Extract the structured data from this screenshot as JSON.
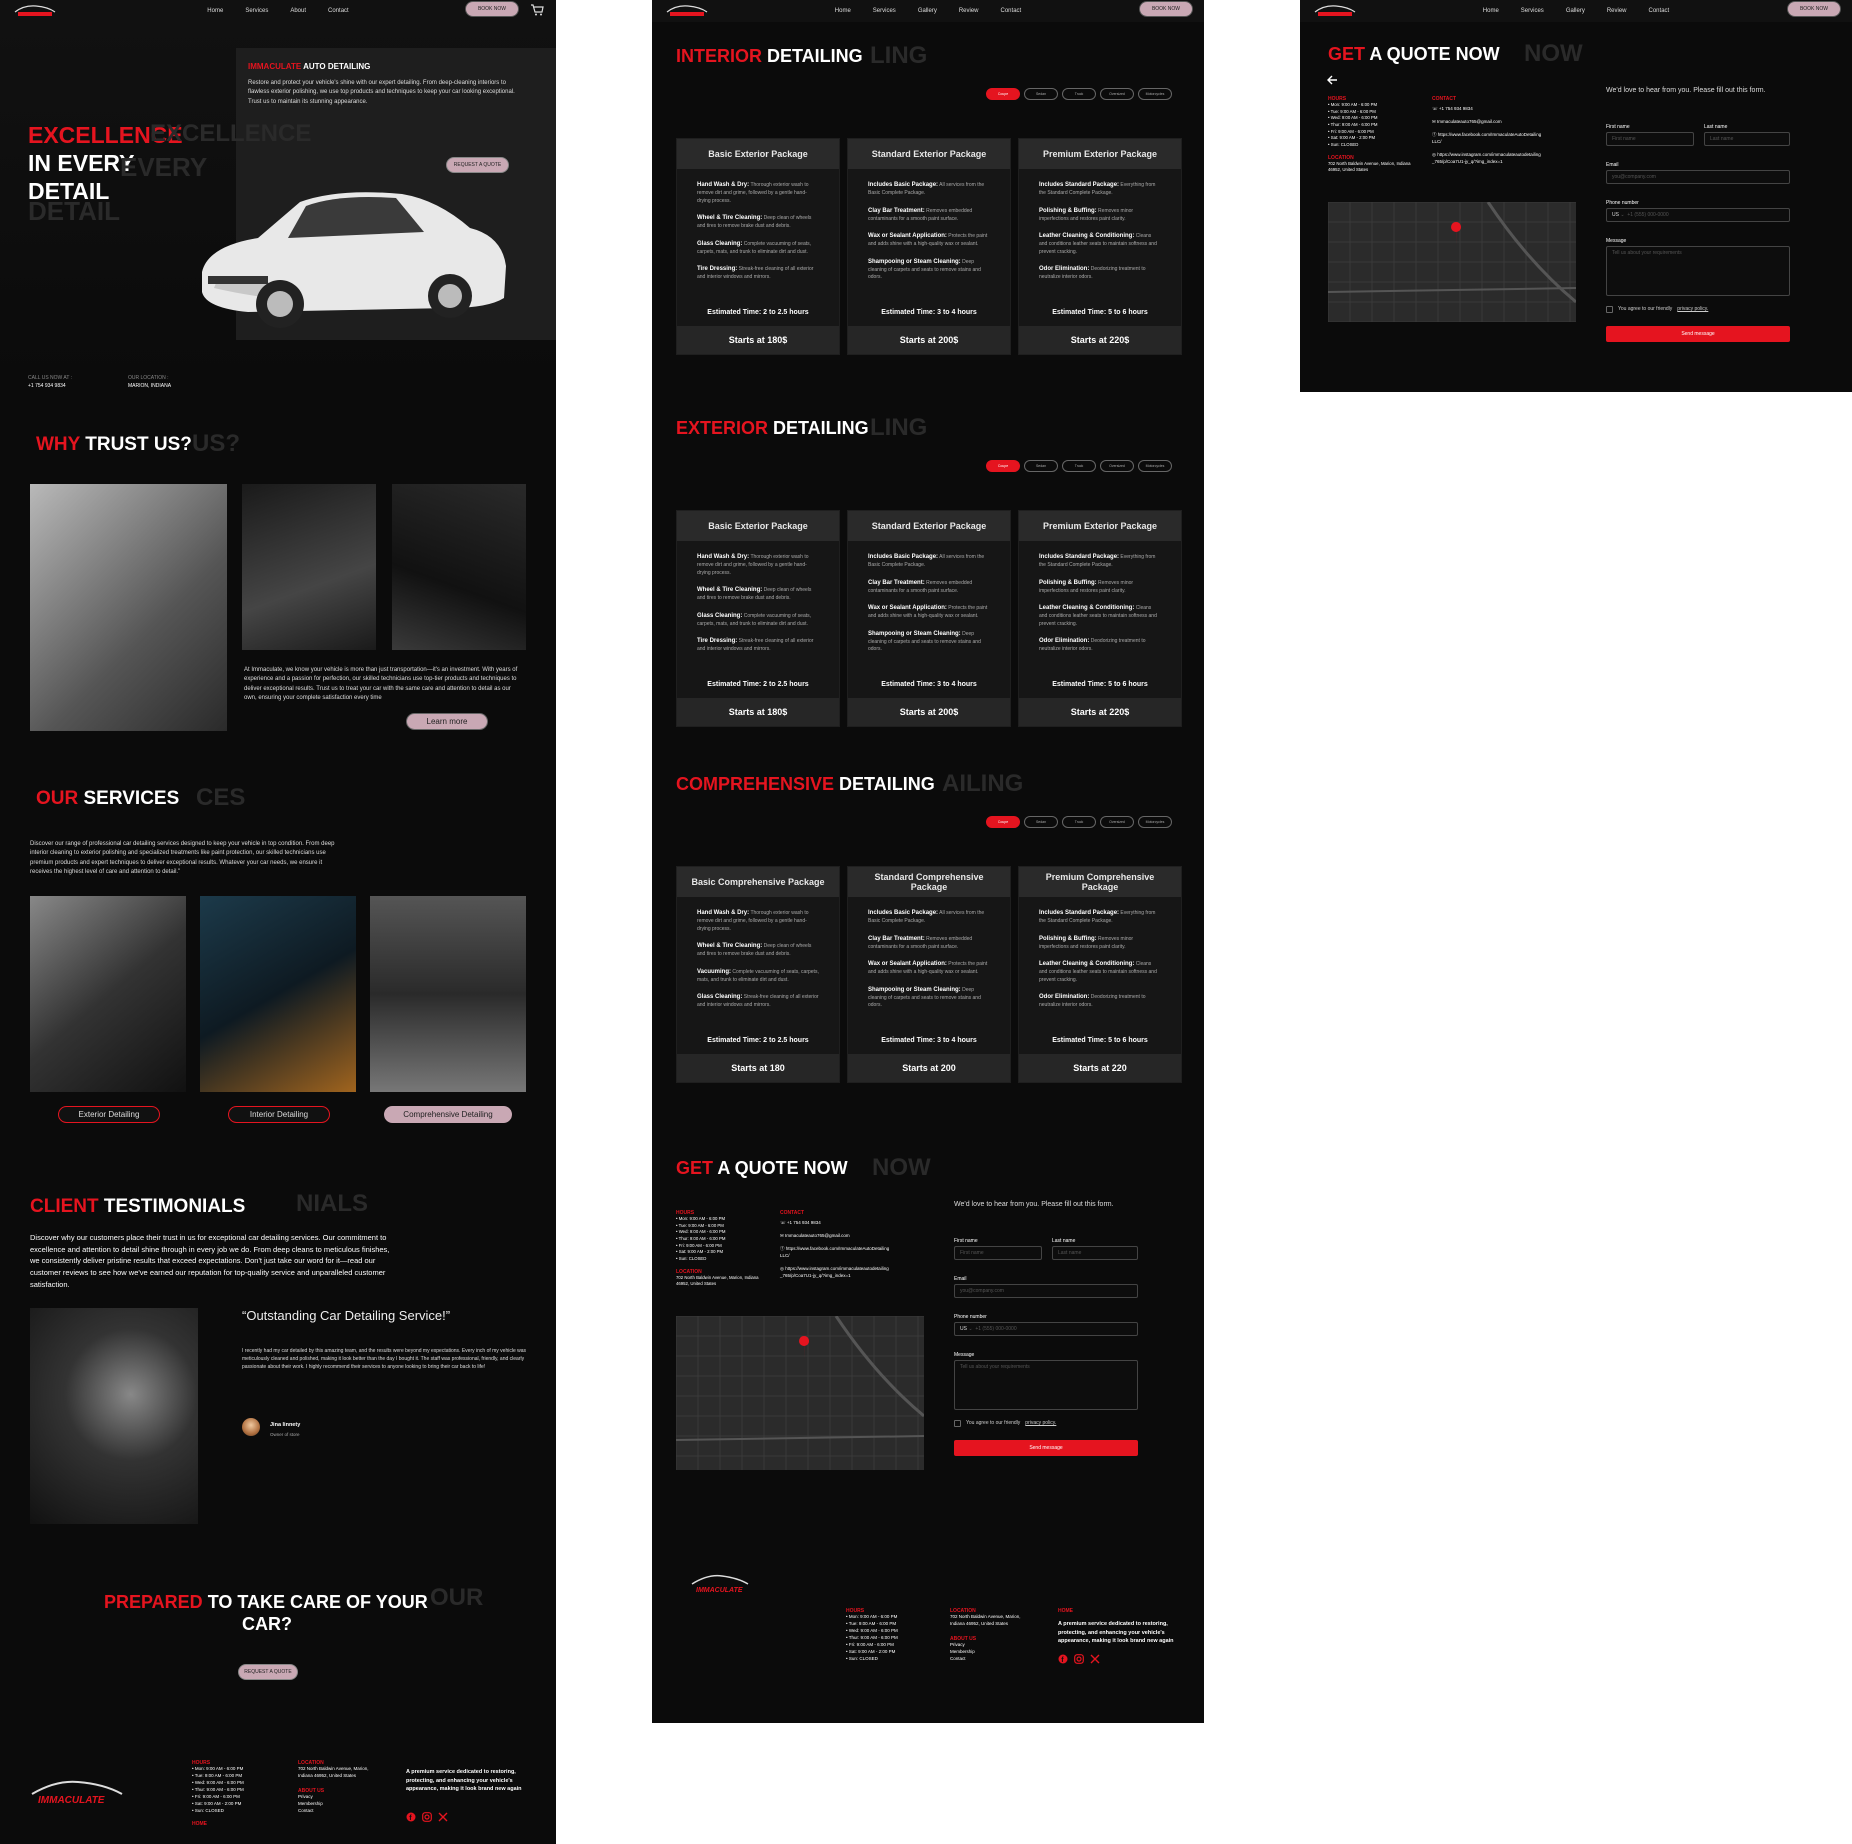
{
  "colors": {
    "accent": "#e5141f",
    "background": "#0b0b0b",
    "pill": "#c9a8b4"
  },
  "brand": {
    "logo_text": "IMMACULATE",
    "logo_sub": "AUTO DETAILING"
  },
  "nav1": {
    "items": [
      "Home",
      "Services",
      "About",
      "Contact"
    ],
    "book": "BOOK NOW"
  },
  "nav2": {
    "items": [
      "Home",
      "Services",
      "Gallery",
      "Review",
      "Contact"
    ],
    "book": "BOOK NOW"
  },
  "hero": {
    "title_red": "EXCELLENCE",
    "title_ghost": "EXCELLENCE",
    "line2": "IN EVERY",
    "line2_ghost": "EVERY",
    "line3": "DETAIL",
    "line3_ghost": "DETAIL",
    "box_title_red": "IMMACULATE",
    "box_title": " AUTO DETAILING",
    "box_text": "Restore and protect your vehicle's shine with our expert detailing. From deep-cleaning interiors to flawless exterior polishing, we use top products and techniques to keep your car looking exceptional. Trust us to maintain its stunning appearance.",
    "quote_btn": "REQUEST A QUOTE",
    "call_label": "CALL US NOW AT :",
    "call": "+1 754 934 9834",
    "loc_label": "OUR LOCATION :",
    "loc": "MARION, INDIANA"
  },
  "trust": {
    "red": "WHY",
    "title": " TRUST US?",
    "ghost": "US?",
    "text": "At Immaculate, we know your vehicle is more than just transportation—it's an investment. With years of experience and a passion for perfection, our skilled technicians use top-tier products and techniques to deliver exceptional results. Trust us to treat your car with the same care and attention to detail as our own, ensuring your complete satisfaction every time",
    "btn": "Learn more"
  },
  "services": {
    "red": "OUR",
    "title": " SERVICES",
    "ghost": "CES",
    "text": "Discover our range of professional car detailing services designed to keep your vehicle in top condition. From deep interior cleaning to exterior polishing and specialized treatments like paint protection, our skilled technicians use premium products and expert techniques to deliver exceptional results. Whatever your car needs, we ensure it receives the highest level of care and attention to detail.\"",
    "items": [
      "Exterior Detailing",
      "Interior Detailing",
      "Comprehensive Detailing"
    ]
  },
  "testimonials": {
    "red": "CLIENT",
    "title": " TESTIMONIALS",
    "ghost": "NIALS",
    "text": "Discover why our customers place their trust in us for exceptional car detailing services. Our commitment to excellence and attention to detail shine through in every job we do. From deep cleans to meticulous finishes, we consistently deliver pristine results that exceed expectations. Don't just take our word for it—read our customer reviews to see how we've earned our reputation for top-quality service and unparalleled customer satisfaction.",
    "quote": "“Outstanding Car Detailing Service!”",
    "review": "I recently had my car detailed by this amazing team, and the results were beyond my expectations. Every inch of my vehicle was meticulously cleaned and polished, making it look better than the day I bought it. The staff was professional, friendly, and clearly passionate about their work. I highly recommend their services to anyone looking to bring their car back to life!",
    "name": "Jina linnety",
    "role": "Owner of store"
  },
  "prepared": {
    "red": "PREPARED",
    "title": " TO TAKE CARE OF YOUR",
    "line2": "CAR?",
    "ghost": "OUR",
    "btn": "REQUEST A QUOTE"
  },
  "footer": {
    "hours_label": "HOURS",
    "hours": [
      "Mon: 9:00 AM - 6:00 PM",
      "Tue: 9:00 AM - 6:00 PM",
      "Wed: 9:00 AM - 6:00 PM",
      "Thur: 9:00 AM - 6:00 PM",
      "Fri: 9:00 AM - 6:00 PM",
      "Sat: 9:00 AM - 2:00 PM",
      "Sun: CLOSED"
    ],
    "location_label": "LOCATION",
    "location": "702 North Baldwin Avenue, Marion, Indiana 46952, United States",
    "about_label": "ABOUT US",
    "links": [
      "Privacy",
      "Membership",
      "Contact"
    ],
    "home_label": "HOME",
    "tagline": "A premium service dedicated to restoring, protecting, and enhancing your vehicle's appearance, making it look brand new again"
  },
  "tabs": [
    "Coupe",
    "Sedan",
    "Truck",
    "Oversized",
    "Motorcycles"
  ],
  "interior": {
    "red": "INTERIOR",
    "title": " DETAILING",
    "ghost": "LING"
  },
  "exterior": {
    "red": "EXTERIOR",
    "title": " DETAILING",
    "ghost": "LING"
  },
  "comprehensive": {
    "red": "COMPREHENSIVE",
    "title": " DETAILING",
    "ghost": "AILING"
  },
  "packages": {
    "names": [
      "Basic Exterior Package",
      "Standard Exterior Package",
      "Premium Exterior Package"
    ],
    "comp_names": [
      "Basic Comprehensive Package",
      "Standard Comprehensive Package",
      "Premium Comprehensive Package"
    ],
    "basic": [
      [
        "Hand Wash & Dry:",
        "Thorough exterior wash to remove dirt and grime, followed by a gentle hand-drying process."
      ],
      [
        "Wheel & Tire Cleaning:",
        "Deep clean of wheels and tires to remove brake dust and debris."
      ],
      [
        "Glass Cleaning:",
        "Complete vacuuming of seats, carpets, mats, and trunk to eliminate dirt and dust."
      ],
      [
        "Tire Dressing:",
        "Streak-free cleaning of all exterior and interior windows and mirrors."
      ]
    ],
    "basic_comp": [
      [
        "Hand Wash & Dry:",
        "Thorough exterior wash to remove dirt and grime, followed by a gentle hand-drying process."
      ],
      [
        "Wheel & Tire Cleaning:",
        "Deep clean of wheels and tires to remove brake dust and debris."
      ],
      [
        "Vacuuming:",
        "Complete vacuuming of seats, carpets, mats, and trunk to eliminate dirt and dust."
      ],
      [
        "Glass Cleaning:",
        "Streak-free cleaning of all exterior and interior windows and mirrors."
      ]
    ],
    "standard": [
      [
        "Includes Basic Package:",
        "All services from the Basic Complete Package."
      ],
      [
        "Clay Bar Treatment:",
        "Removes embedded contaminants for a smooth paint surface."
      ],
      [
        "Wax or Sealant Application:",
        "Protects the paint and adds shine with a high-quality wax or sealant."
      ],
      [
        "Shampooing or Steam Cleaning:",
        "Deep cleaning of carpets and seats to remove stains and odors."
      ]
    ],
    "premium": [
      [
        "Includes Standard Package:",
        "Everything from the Standard Complete Package."
      ],
      [
        "Polishing & Buffing:",
        "Removes minor imperfections and restores paint clarity."
      ],
      [
        "Leather Cleaning & Conditioning:",
        "Cleans and conditions leather seats to maintain softness and prevent cracking."
      ],
      [
        "Odor Elimination:",
        "Deodorizing treatment to neutralize interior odors."
      ]
    ],
    "est": [
      "Estimated Time: 2 to 2.5 hours",
      "Estimated Time: 3 to 4 hours",
      "Estimated Time: 5 to 6 hours"
    ],
    "prices": [
      "Starts at 180$",
      "Starts at 200$",
      "Starts at 220$"
    ],
    "comp_prices": [
      "Starts at 180",
      "Starts at 200",
      "Starts at 220"
    ]
  },
  "quote": {
    "red": "GET",
    "title": " A QUOTE NOW",
    "ghost": "NOW",
    "hours_label": "HOURS",
    "contact_label": "CONTACT",
    "location_label": "LOCATION",
    "phone": "+1 754 934 9834",
    "email": "Immaculateauto765@gmail.com",
    "facebook": "https://www.facebook.com/ImmaculateAutoDetailingLLC/",
    "instagram": "https://www.instagram.com/immaculateautodetailing_765/p/Coa7U1-jy_q/?img_index=1",
    "location": "702 North Baldwin Avenue, Marion, Indiana 46952, United States",
    "intro": "We'd love to hear from you. Please fill out this form.",
    "first_label": "First name",
    "first_ph": "First name",
    "last_label": "Last name",
    "last_ph": "Last name",
    "email_label": "Email",
    "email_ph": "you@company.com",
    "phone_label": "Phone number",
    "country": "US",
    "phone_ph": "+1 (555) 000-0000",
    "message_label": "Message",
    "message_ph": "Tell us about your requirements",
    "agree": "You agree to our friendly ",
    "privacy": "privacy policy.",
    "send": "Send message"
  }
}
